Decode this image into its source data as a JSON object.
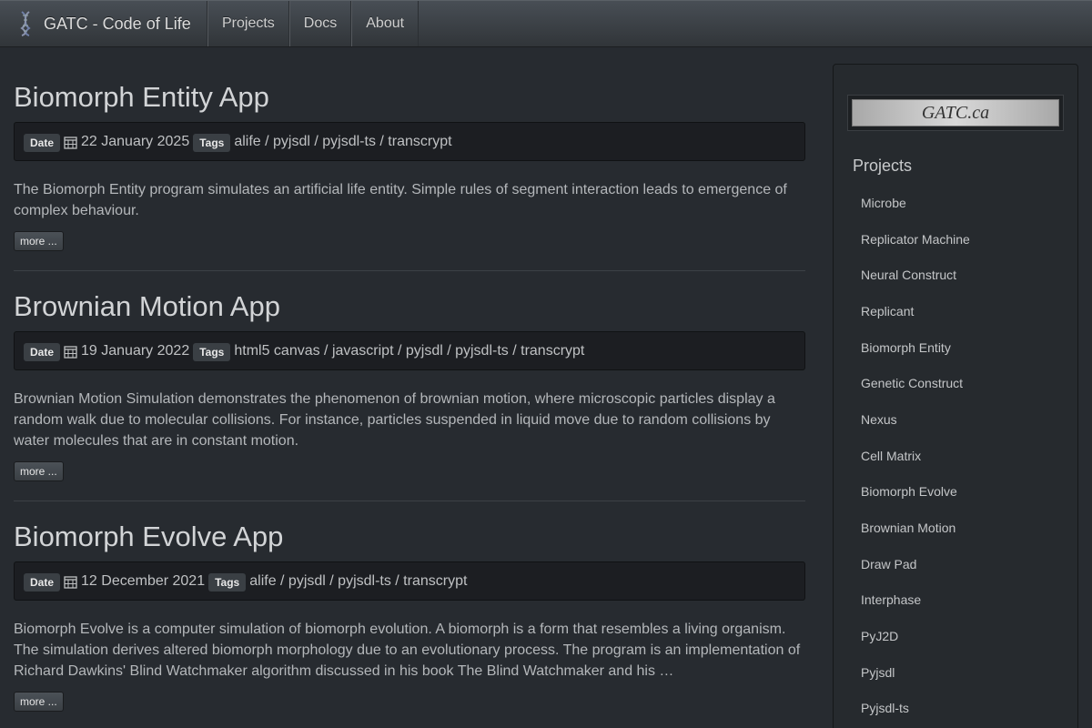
{
  "navbar": {
    "brand": "GATC - Code of Life",
    "links": [
      "Projects",
      "Docs",
      "About"
    ]
  },
  "labels": {
    "date": "Date",
    "tags": "Tags",
    "more": "more ..."
  },
  "posts": [
    {
      "title": "Biomorph Entity App",
      "date": "22 January 2025",
      "tags": "alife / pyjsdl / pyjsdl-ts / transcrypt",
      "summary": "The Biomorph Entity program simulates an artificial life entity. Simple rules of segment interaction leads to emergence of complex behaviour."
    },
    {
      "title": "Brownian Motion App",
      "date": "19 January 2022",
      "tags": "html5 canvas / javascript / pyjsdl / pyjsdl-ts / transcrypt",
      "summary": "Brownian Motion Simulation demonstrates the phenomenon of brownian motion, where microscopic particles display a random walk due to molecular collisions. For instance, particles suspended in liquid move due to random collisions by water molecules that are in constant motion."
    },
    {
      "title": "Biomorph Evolve App",
      "date": "12 December 2021",
      "tags": "alife / pyjsdl / pyjsdl-ts / transcrypt",
      "summary": "Biomorph Evolve is a computer simulation of biomorph evolution. A biomorph is a form that resembles a living organism. The simulation derives altered biomorph morphology due to an evolutionary process. The program is an implementation of Richard Dawkins' Blind Watchmaker algorithm discussed in his book The Blind Watchmaker and his …"
    }
  ],
  "sidebar": {
    "logo_text": "GATC.ca",
    "heading": "Projects",
    "items": [
      "Microbe",
      "Replicator Machine",
      "Neural Construct",
      "Replicant",
      "Biomorph Entity",
      "Genetic Construct",
      "Nexus",
      "Cell Matrix",
      "Biomorph Evolve",
      "Brownian Motion",
      "Draw Pad",
      "Interphase",
      "PyJ2D",
      "Pyjsdl",
      "Pyjsdl-ts"
    ]
  },
  "icons": {
    "brand": "dna-icon",
    "date": "calendar-icon"
  },
  "colors": {
    "background": "#272b30",
    "navbar": "#3a3f44",
    "label": "#3a3f44"
  }
}
